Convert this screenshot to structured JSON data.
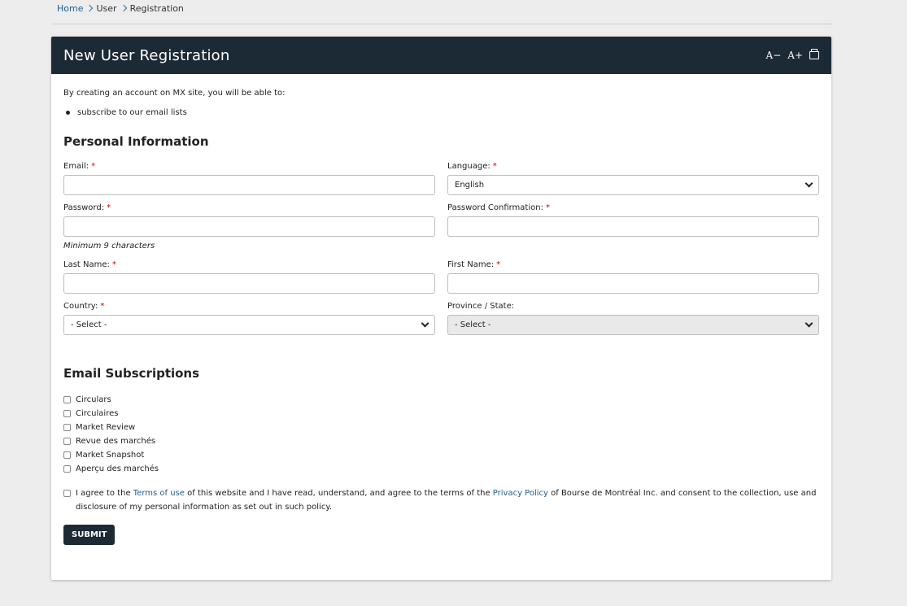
{
  "breadcrumb": {
    "home": "Home",
    "user": "User",
    "current": "Registration"
  },
  "header": {
    "title": "New User Registration",
    "decrease_font": "A−",
    "increase_font": "A+"
  },
  "intro": {
    "text": "By creating an account on MX site, you will be able to:",
    "bullet": "subscribe to our email lists"
  },
  "personal": {
    "heading": "Personal Information",
    "email_label": "Email:",
    "language_label": "Language:",
    "language_value": "English",
    "password_label": "Password:",
    "password_confirm_label": "Password Confirmation:",
    "password_hint": "Minimum 9 characters",
    "last_name_label": "Last Name:",
    "first_name_label": "First Name:",
    "country_label": "Country:",
    "country_value": "- Select -",
    "province_label": "Province / State:",
    "province_value": "- Select -",
    "required_mark": "*"
  },
  "subscriptions": {
    "heading": "Email Subscriptions",
    "items": [
      "Circulars",
      "Circulaires",
      "Market Review",
      "Revue des marchés",
      "Market Snapshot",
      "Aperçu des marchés"
    ]
  },
  "agreement": {
    "part1": "I agree to the ",
    "terms_link": "Terms of use",
    "part2": " of this website and I have read, understand, and agree to the terms of the ",
    "privacy_link": "Privacy Policy",
    "part3": " of Bourse de Montréal Inc. and consent to the collection, use and disclosure of my personal information as set out in such policy."
  },
  "submit_label": "SUBMIT"
}
